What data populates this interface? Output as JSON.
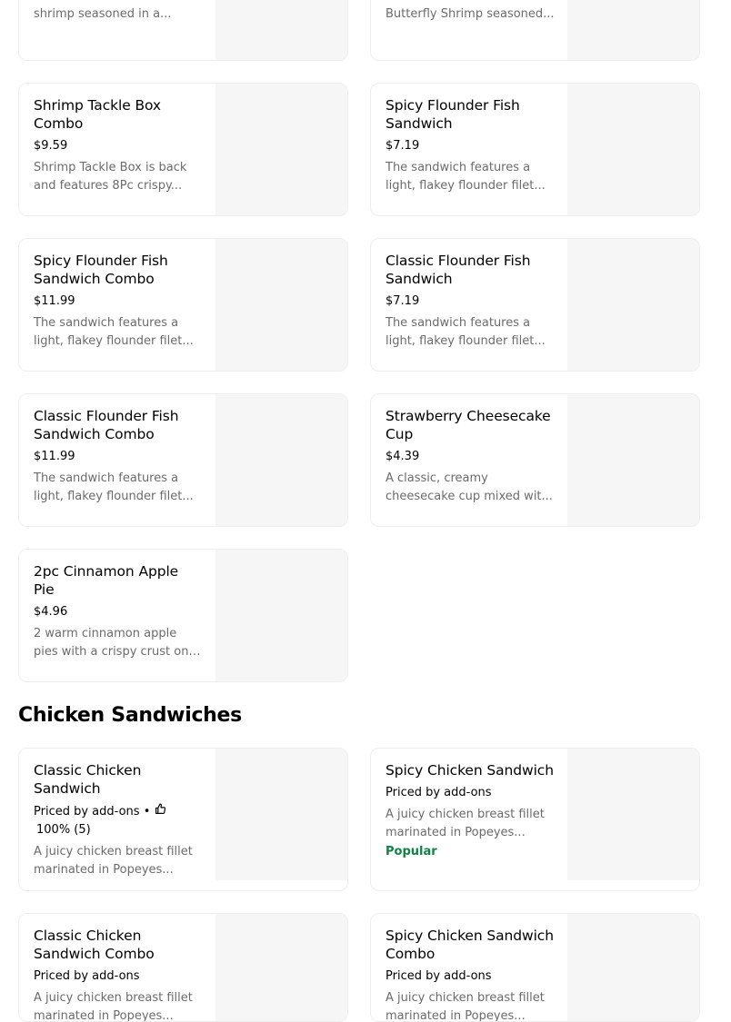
{
  "sections": [
    {
      "title": "",
      "items": [
        {
          "name": "",
          "price": "",
          "desc": "shrimp seasoned in a..."
        },
        {
          "name": "",
          "price": "",
          "desc": "Butterfly Shrimp seasoned..."
        },
        {
          "name": "Shrimp Tackle Box Combo",
          "price": "$9.59",
          "desc": "Shrimp Tackle Box is back and features 8Pc crispy..."
        },
        {
          "name": "Spicy Flounder Fish Sandwich",
          "price": "$7.19",
          "desc": "The sandwich features a light, flakey flounder filet..."
        },
        {
          "name": "Spicy Flounder Fish Sandwich Combo",
          "price": "$11.99",
          "desc": "The sandwich features a light, flakey flounder filet..."
        },
        {
          "name": "Classic Flounder Fish Sandwich",
          "price": "$7.19",
          "desc": "The sandwich features a light, flakey flounder filet..."
        },
        {
          "name": "Classic Flounder Fish Sandwich Combo",
          "price": "$11.99",
          "desc": "The sandwich features a light, flakey flounder filet..."
        },
        {
          "name": "Strawberry Cheesecake Cup",
          "price": "$4.39",
          "desc": "A classic, creamy cheesecake cup mixed wit..."
        },
        {
          "name": "2pc Cinnamon Apple Pie",
          "price": "$4.96",
          "desc": "2 warm cinnamon apple pies with a crispy crust on the..."
        }
      ]
    },
    {
      "title": "Chicken Sandwiches",
      "items": [
        {
          "name": "Classic Chicken Sandwich",
          "price": "Priced by add-ons",
          "separator": "•",
          "rating": "100% (5)",
          "desc": "A juicy chicken breast fillet marinated in Popeyes..."
        },
        {
          "name": "Spicy Chicken Sandwich",
          "price": "Priced by add-ons",
          "desc": "A juicy chicken breast fillet marinated in Popeyes...",
          "badge": "Popular"
        },
        {
          "name": "Classic Chicken Sandwich Combo",
          "price": "Priced by add-ons",
          "desc": "A juicy chicken breast fillet marinated in Popeyes..."
        },
        {
          "name": "Spicy Chicken Sandwich Combo",
          "price": "Priced by add-ons",
          "desc": "A juicy chicken breast fillet marinated in Popeyes..."
        }
      ]
    }
  ],
  "colors": {
    "accent_green": "#0e8345",
    "muted_text": "#6b6b6b",
    "image_placeholder": "#f6f6f6"
  },
  "icons": {
    "rating": "thumbs-up-icon"
  }
}
